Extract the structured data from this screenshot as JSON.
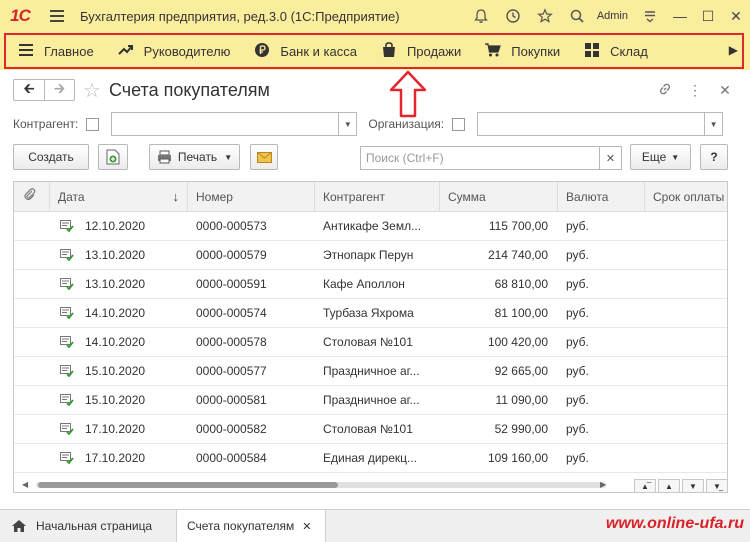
{
  "titlebar": {
    "logo": "1С",
    "title": "Бухгалтерия предприятия, ред.3.0  (1С:Предприятие)",
    "user": "Admin"
  },
  "sections": [
    {
      "label": "Главное",
      "icon": "menu-icon"
    },
    {
      "label": "Руководителю",
      "icon": "trend-icon"
    },
    {
      "label": "Банк и касса",
      "icon": "ruble-icon"
    },
    {
      "label": "Продажи",
      "icon": "bag-icon"
    },
    {
      "label": "Покупки",
      "icon": "cart-icon"
    },
    {
      "label": "Склад",
      "icon": "grid-icon"
    }
  ],
  "form": {
    "title": "Счета покупателям"
  },
  "filters": {
    "counterparty_label": "Контрагент:",
    "organization_label": "Организация:"
  },
  "toolbar": {
    "create_label": "Создать",
    "print_label": "Печать",
    "search_placeholder": "Поиск (Ctrl+F)",
    "more_label": "Еще",
    "help_label": "?"
  },
  "table": {
    "columns": [
      "Дата",
      "Номер",
      "Контрагент",
      "Сумма",
      "Валюта",
      "Срок оплаты"
    ],
    "rows": [
      {
        "date": "12.10.2020",
        "number": "0000-000573",
        "counterparty": "Антикафе Земл...",
        "sum": "115 700,00",
        "currency": "руб."
      },
      {
        "date": "13.10.2020",
        "number": "0000-000579",
        "counterparty": "Этнопарк Перун",
        "sum": "214 740,00",
        "currency": "руб."
      },
      {
        "date": "13.10.2020",
        "number": "0000-000591",
        "counterparty": "Кафе Аполлон",
        "sum": "68 810,00",
        "currency": "руб."
      },
      {
        "date": "14.10.2020",
        "number": "0000-000574",
        "counterparty": "Турбаза Яхрома",
        "sum": "81 100,00",
        "currency": "руб."
      },
      {
        "date": "14.10.2020",
        "number": "0000-000578",
        "counterparty": "Столовая №101",
        "sum": "100 420,00",
        "currency": "руб."
      },
      {
        "date": "15.10.2020",
        "number": "0000-000577",
        "counterparty": "Праздничное аг...",
        "sum": "92 665,00",
        "currency": "руб."
      },
      {
        "date": "15.10.2020",
        "number": "0000-000581",
        "counterparty": "Праздничное аг...",
        "sum": "11 090,00",
        "currency": "руб."
      },
      {
        "date": "17.10.2020",
        "number": "0000-000582",
        "counterparty": "Столовая №101",
        "sum": "52 990,00",
        "currency": "руб."
      },
      {
        "date": "17.10.2020",
        "number": "0000-000584",
        "counterparty": "Единая дирекц...",
        "sum": "109 160,00",
        "currency": "руб."
      }
    ]
  },
  "tabs": {
    "home_label": "Начальная страница",
    "active_label": "Счета покупателям"
  },
  "watermark": "www.online-ufa.ru",
  "colors": {
    "panel_bg": "#fbed9e",
    "highlight": "#e3262d",
    "brand_red": "#d8232a"
  }
}
